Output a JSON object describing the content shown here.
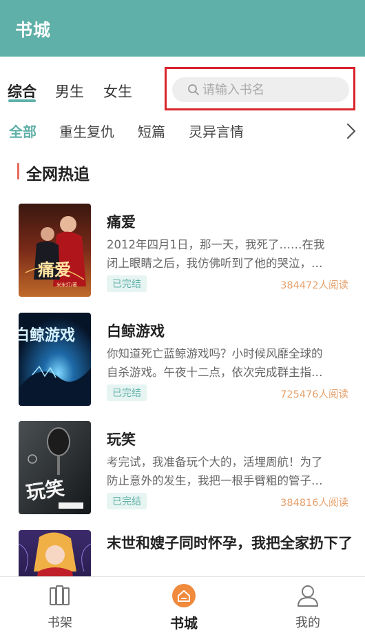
{
  "header": {
    "title": "书城"
  },
  "gender_tabs": [
    {
      "label": "综合",
      "active": true
    },
    {
      "label": "男生",
      "active": false
    },
    {
      "label": "女生",
      "active": false
    }
  ],
  "search": {
    "placeholder": "请输入书名",
    "value": ""
  },
  "categories": [
    {
      "label": "全部",
      "active": true
    },
    {
      "label": "重生复仇",
      "active": false
    },
    {
      "label": "短篇",
      "active": false
    },
    {
      "label": "灵异言情",
      "active": false
    }
  ],
  "section": {
    "title": "全网热追"
  },
  "books": [
    {
      "title": "痛爱",
      "desc_line1": "2012年四月1日，那一天，我死了……在我",
      "desc_line2": "闭上眼睛之后，我仿佛听到了他的哭泣，…",
      "status": "已完结",
      "reads": "384472人阅读",
      "cover_text": "痛爱",
      "cover_author": "米米灯/著"
    },
    {
      "title": "白鲸游戏",
      "desc_line1": "你知道死亡蓝鲸游戏吗？小时候风靡全球的",
      "desc_line2": "自杀游戏。午夜十二点，依次完成群主指…",
      "status": "已完结",
      "reads": "725476人阅读",
      "cover_text": "白鲸游戏"
    },
    {
      "title": "玩笑",
      "desc_line1": "考完试，我准备玩个大的，活埋周航！为了",
      "desc_line2": "防止意外的发生，我把一根手臂粗的管子…",
      "status": "已完结",
      "reads": "384816人阅读",
      "cover_text": "玩笑"
    },
    {
      "title": "末世和嫂子同时怀孕，我把全家扔下了",
      "desc_line1": "",
      "desc_line2": ""
    }
  ],
  "bottom_tabs": [
    {
      "label": "书架",
      "icon": "bookshelf-icon",
      "active": false
    },
    {
      "label": "书城",
      "icon": "store-home-icon",
      "active": true
    },
    {
      "label": "我的",
      "icon": "profile-icon",
      "active": false
    }
  ],
  "colors": {
    "brand": "#5fb0a8",
    "highlight_frame": "#d9242c",
    "reads_orange": "#e6a06b",
    "active_tab_orange": "#f08a3c"
  }
}
